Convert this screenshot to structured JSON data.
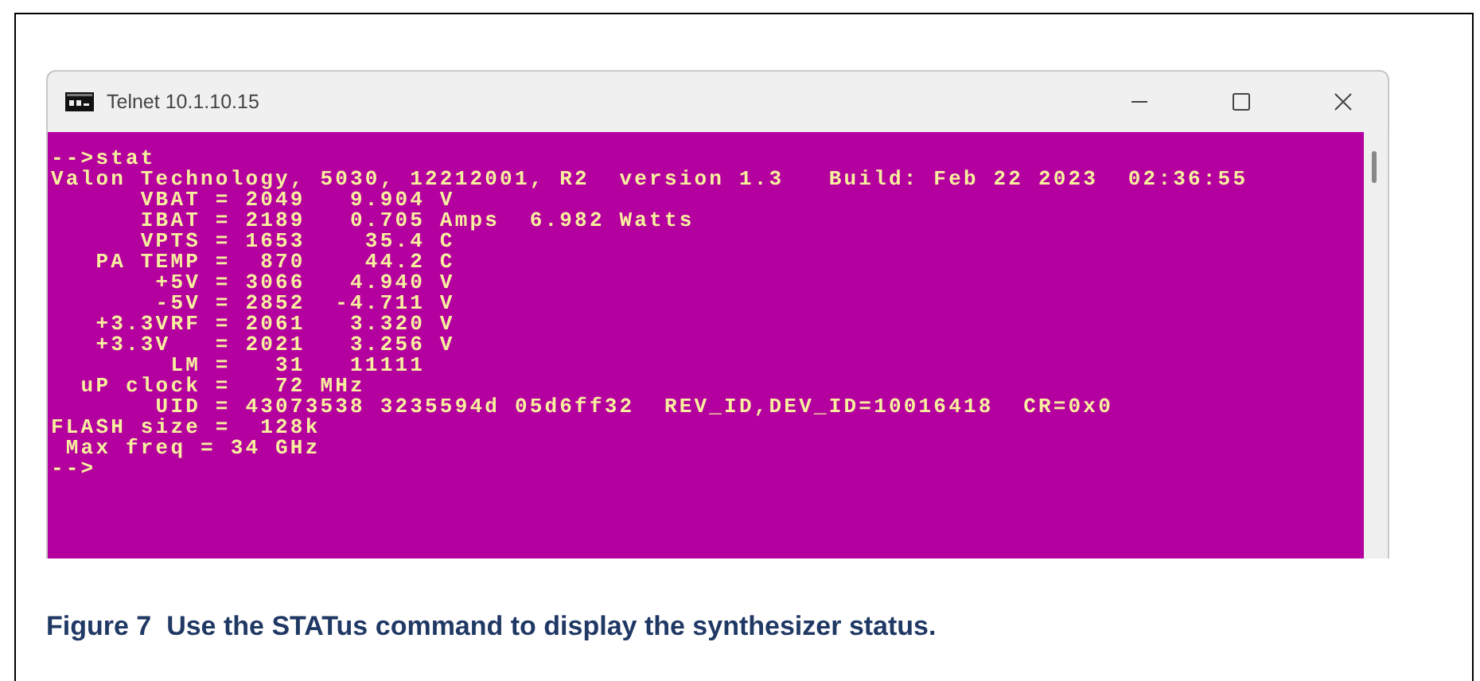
{
  "window": {
    "title": "Telnet 10.1.10.15"
  },
  "terminal": {
    "lines": [
      "-->stat",
      "Valon Technology, 5030, 12212001, R2  version 1.3   Build: Feb 22 2023  02:36:55",
      "      VBAT = 2049   9.904 V",
      "      IBAT = 2189   0.705 Amps  6.982 Watts",
      "      VPTS = 1653    35.4 C",
      "   PA TEMP =  870    44.2 C",
      "       +5V = 3066   4.940 V",
      "       -5V = 2852  -4.711 V",
      "   +3.3VRF = 2061   3.320 V",
      "   +3.3V   = 2021   3.256 V",
      "        LM =   31   11111",
      "  uP clock =   72 MHz",
      "       UID = 43073538 3235594d 05d6ff32  REV_ID,DEV_ID=10016418  CR=0x0",
      "FLASH size =  128k",
      " Max freq = 34 GHz",
      "-->"
    ]
  },
  "caption": "Figure 7  Use the STATus command to display the synthesizer status."
}
